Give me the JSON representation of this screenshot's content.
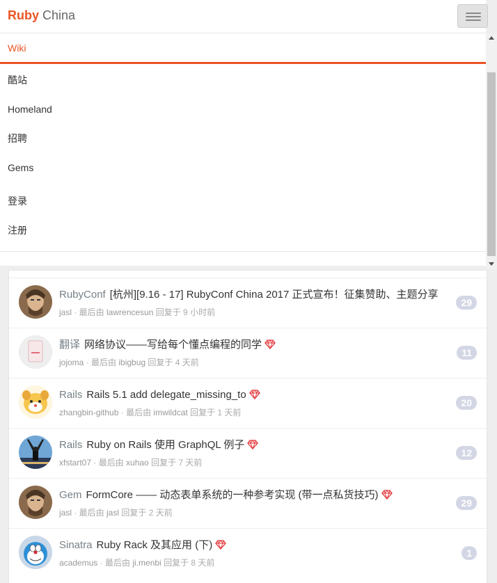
{
  "brand": {
    "ruby": "Ruby",
    "china": "China"
  },
  "menu": {
    "active": "Wiki",
    "items": [
      "酷站",
      "Homeland",
      "招聘",
      "Gems"
    ],
    "login": "登录",
    "register": "注册"
  },
  "colors": {
    "brand": "#eb5424",
    "badge": "#d3d6e4",
    "gem": "#e2363a"
  },
  "topics": [
    {
      "node": "RubyConf",
      "title": "[杭州][9.16 - 17] RubyConf China 2017 正式宣布！征集赞助、主题分享",
      "excellent": false,
      "author": "jasl",
      "sep": " · 最后由 ",
      "last": "lawrencesun",
      "time": " 回复于 9 小时前",
      "replies": "29",
      "avatar": "portrait-man-icon"
    },
    {
      "node": "翻译",
      "title": "网络协议——写给每个懂点编程的同学",
      "excellent": true,
      "author": "jojoma",
      "sep": " · 最后由 ",
      "last": "ibigbug",
      "time": " 回复于 4 天前",
      "replies": "11",
      "avatar": "light-box-icon"
    },
    {
      "node": "Rails",
      "title": "Rails 5.1 add delegate_missing_to",
      "excellent": true,
      "author": "zhangbin-github",
      "sep": " · 最后由 ",
      "last": "imwildcat",
      "time": " 回复于 1 天前",
      "replies": "20",
      "avatar": "cartoon-dog-icon"
    },
    {
      "node": "Rails",
      "title": "Ruby on Rails 使用 GraphQL 例子",
      "excellent": true,
      "author": "xfstart07",
      "sep": " · 最后由 ",
      "last": "xuhao",
      "time": " 回复于 7 天前",
      "replies": "12",
      "avatar": "raised-arms-icon"
    },
    {
      "node": "Gem",
      "title": "FormCore —— 动态表单系统的一种参考实现 (带一点私货技巧)",
      "excellent": true,
      "author": "jasl",
      "sep": " · 最后由 ",
      "last": "jasl",
      "time": " 回复于 2 天前",
      "replies": "29",
      "avatar": "portrait-man-icon"
    },
    {
      "node": "Sinatra",
      "title": "Ruby Rack 及其应用 (下)",
      "excellent": true,
      "author": "academus",
      "sep": " · 最后由 ",
      "last": "ji.menbi",
      "time": " 回复于 8 天前",
      "replies": "1",
      "avatar": "doraemon-icon"
    }
  ]
}
